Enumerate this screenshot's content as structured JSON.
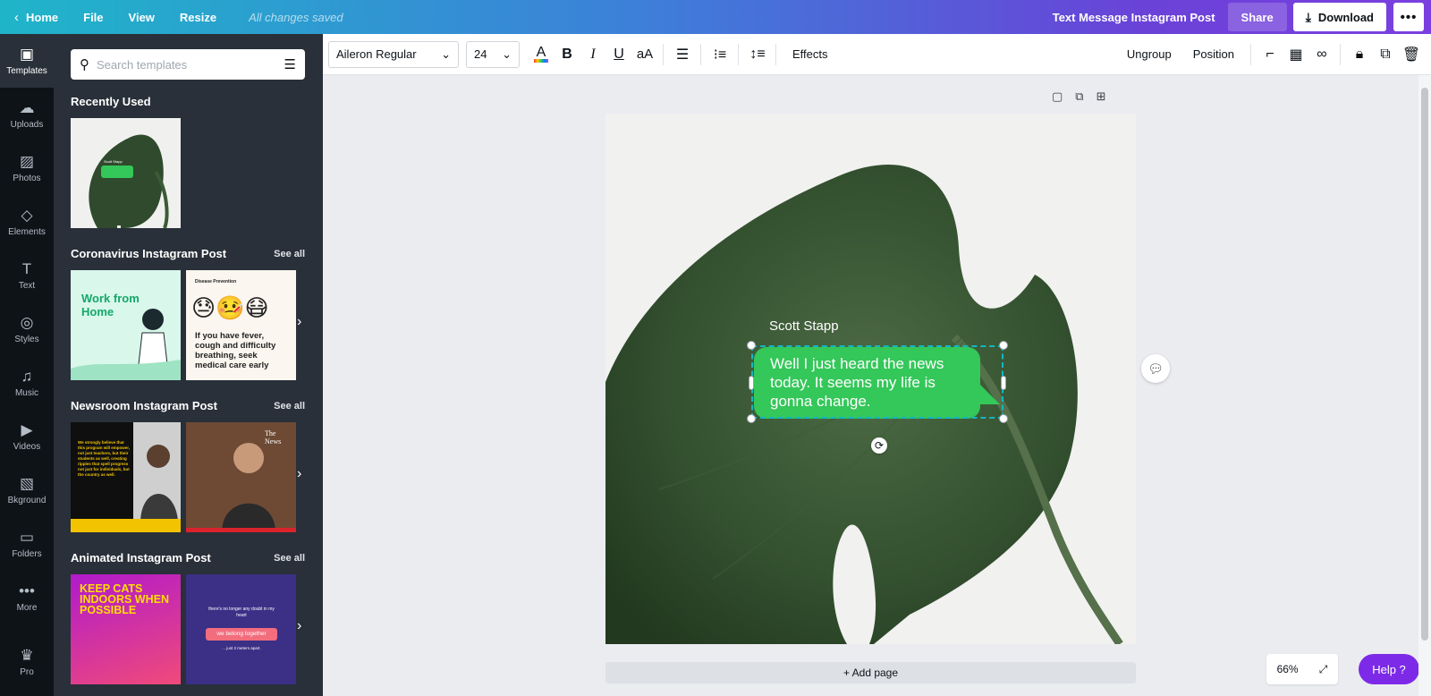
{
  "topbar": {
    "home": "Home",
    "file": "File",
    "view": "View",
    "resize": "Resize",
    "saved": "All changes saved",
    "doc_title": "Text Message Instagram Post",
    "share": "Share",
    "download": "Download",
    "more": "•••"
  },
  "rail": [
    {
      "label": "Templates",
      "icon": "▣"
    },
    {
      "label": "Uploads",
      "icon": "☁"
    },
    {
      "label": "Photos",
      "icon": "▨"
    },
    {
      "label": "Elements",
      "icon": "◇"
    },
    {
      "label": "Text",
      "icon": "T"
    },
    {
      "label": "Styles",
      "icon": "◎"
    },
    {
      "label": "Music",
      "icon": "♫"
    },
    {
      "label": "Videos",
      "icon": "▶"
    },
    {
      "label": "Bkground",
      "icon": "▧"
    },
    {
      "label": "Folders",
      "icon": "▭"
    },
    {
      "label": "More",
      "icon": "•••"
    },
    {
      "label": "Pro",
      "icon": "♛"
    }
  ],
  "panel": {
    "search_placeholder": "Search templates",
    "see_all": "See all",
    "recently_used": "Recently Used",
    "sections": [
      {
        "title": "Coronavirus Instagram Post"
      },
      {
        "title": "Newsroom Instagram Post"
      },
      {
        "title": "Animated Instagram Post"
      }
    ],
    "thumbs": {
      "recent_name": "Scott Stapp",
      "covid1_title": "Work from Home",
      "covid2_header": "Disease Prevention",
      "covid2_emoji": "😓🤒😷",
      "covid2_text": "If you have fever, cough and difficulty breathing, seek medical care early",
      "news1_text": "We strongly believe that this program will empower, not just teachers, but their students as well, creating ripples that spell progress not just for individuals, but the country as well.",
      "news2_brand": "The News",
      "anim1_text": "KEEP CATS INDOORS WHEN POSSIBLE",
      "anim2_top": "there's no longer any doubt in my heart",
      "anim2_pill": "we belong together",
      "anim2_bottom": "... just 2 meters apart."
    }
  },
  "toolbar": {
    "font": "Aileron Regular",
    "size": "24",
    "effects": "Effects",
    "ungroup": "Ungroup",
    "position": "Position"
  },
  "canvas": {
    "sender": "Scott Stapp",
    "message": "Well I just heard the news today. It seems my life is gonna change.",
    "add_page": "+ Add page",
    "zoom": "66%",
    "help": "Help ?"
  },
  "colors": {
    "bubble": "#34c759",
    "selection": "#12b6c3",
    "help": "#7d2ae8"
  }
}
